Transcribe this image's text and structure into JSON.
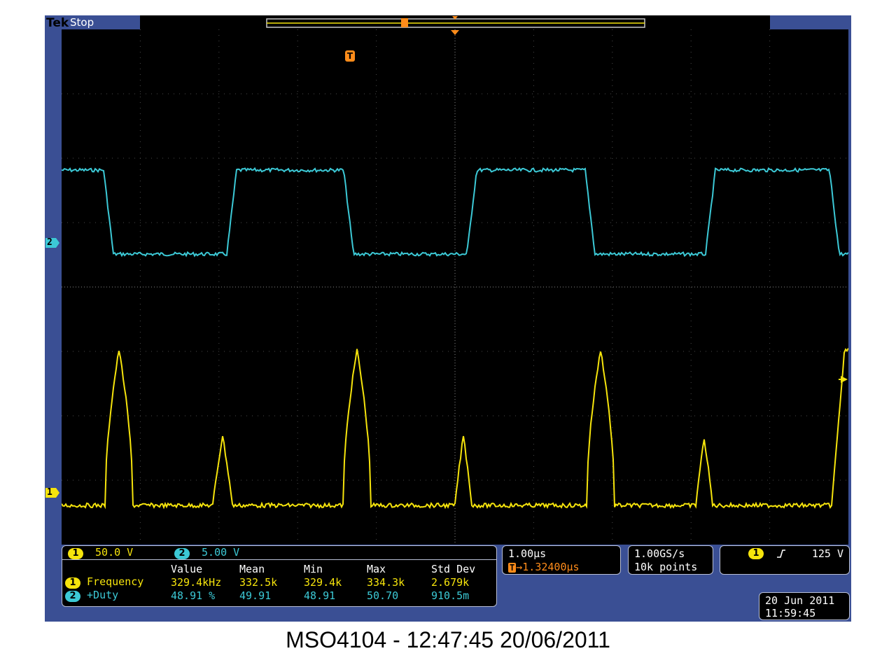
{
  "scope": {
    "brand": "Tek",
    "acq_state": "Stop",
    "trigger_marker": "T",
    "ch2_marker": "2",
    "ch1_marker": "1"
  },
  "channels": {
    "ch1": {
      "label": "1",
      "scale": "50.0 V",
      "color": "#f6e40c"
    },
    "ch2": {
      "label": "2",
      "scale": "5.00 V",
      "color": "#3cc9d6"
    }
  },
  "measurements": {
    "headers": [
      "Value",
      "Mean",
      "Min",
      "Max",
      "Std Dev"
    ],
    "rows": [
      {
        "ch": "1",
        "name": "Frequency",
        "value": "329.4kHz",
        "mean": "332.5k",
        "min": "329.4k",
        "max": "334.3k",
        "std": "2.679k"
      },
      {
        "ch": "2",
        "name": "+Duty",
        "value": "48.91 %",
        "mean": "49.91",
        "min": "48.91",
        "max": "50.70",
        "std": "910.5m"
      }
    ]
  },
  "timebase": {
    "scale": "1.00µs",
    "trigger_position": "→1.32400µs"
  },
  "acquisition": {
    "rate": "1.00GS/s",
    "record": "10k points"
  },
  "trigger": {
    "source": "1",
    "slope": "rising-edge-icon",
    "level": "125 V"
  },
  "datetime": {
    "date": "20 Jun  2011",
    "time": "11:59:45"
  },
  "caption": "MSO4104 - 12:47:45   20/06/2011",
  "colors": {
    "screen_bg": "#3a4f94",
    "ch1": "#f6e40c",
    "ch2": "#3cc9d6",
    "trigger": "#ff8c1a"
  }
}
